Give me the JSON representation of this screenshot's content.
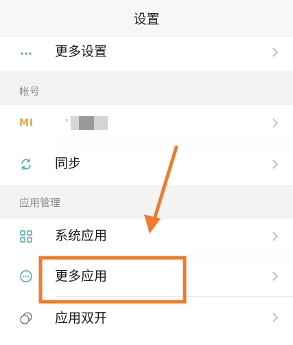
{
  "header": {
    "title": "设置"
  },
  "rows": {
    "more_settings": {
      "label": "更多设置",
      "icon": "ellipsis-icon"
    },
    "account_mi": {
      "icon_text": "MI",
      "icon": "mi-logo-icon"
    },
    "sync": {
      "label": "同步",
      "icon": "sync-icon"
    },
    "system_apps": {
      "label": "系统应用",
      "icon": "grid-icon"
    },
    "more_apps": {
      "label": "更多应用",
      "icon": "more-circle-icon"
    },
    "dual_apps": {
      "label": "应用双开",
      "icon": "dual-circle-icon"
    }
  },
  "sections": {
    "account": "帐号",
    "app_management": "应用管理"
  },
  "colors": {
    "accent_orange": "#f07b2c",
    "icon_teal": "#3aa6b3",
    "mi_orange": "#e8a53a",
    "chevron": "#b8b8b8"
  }
}
